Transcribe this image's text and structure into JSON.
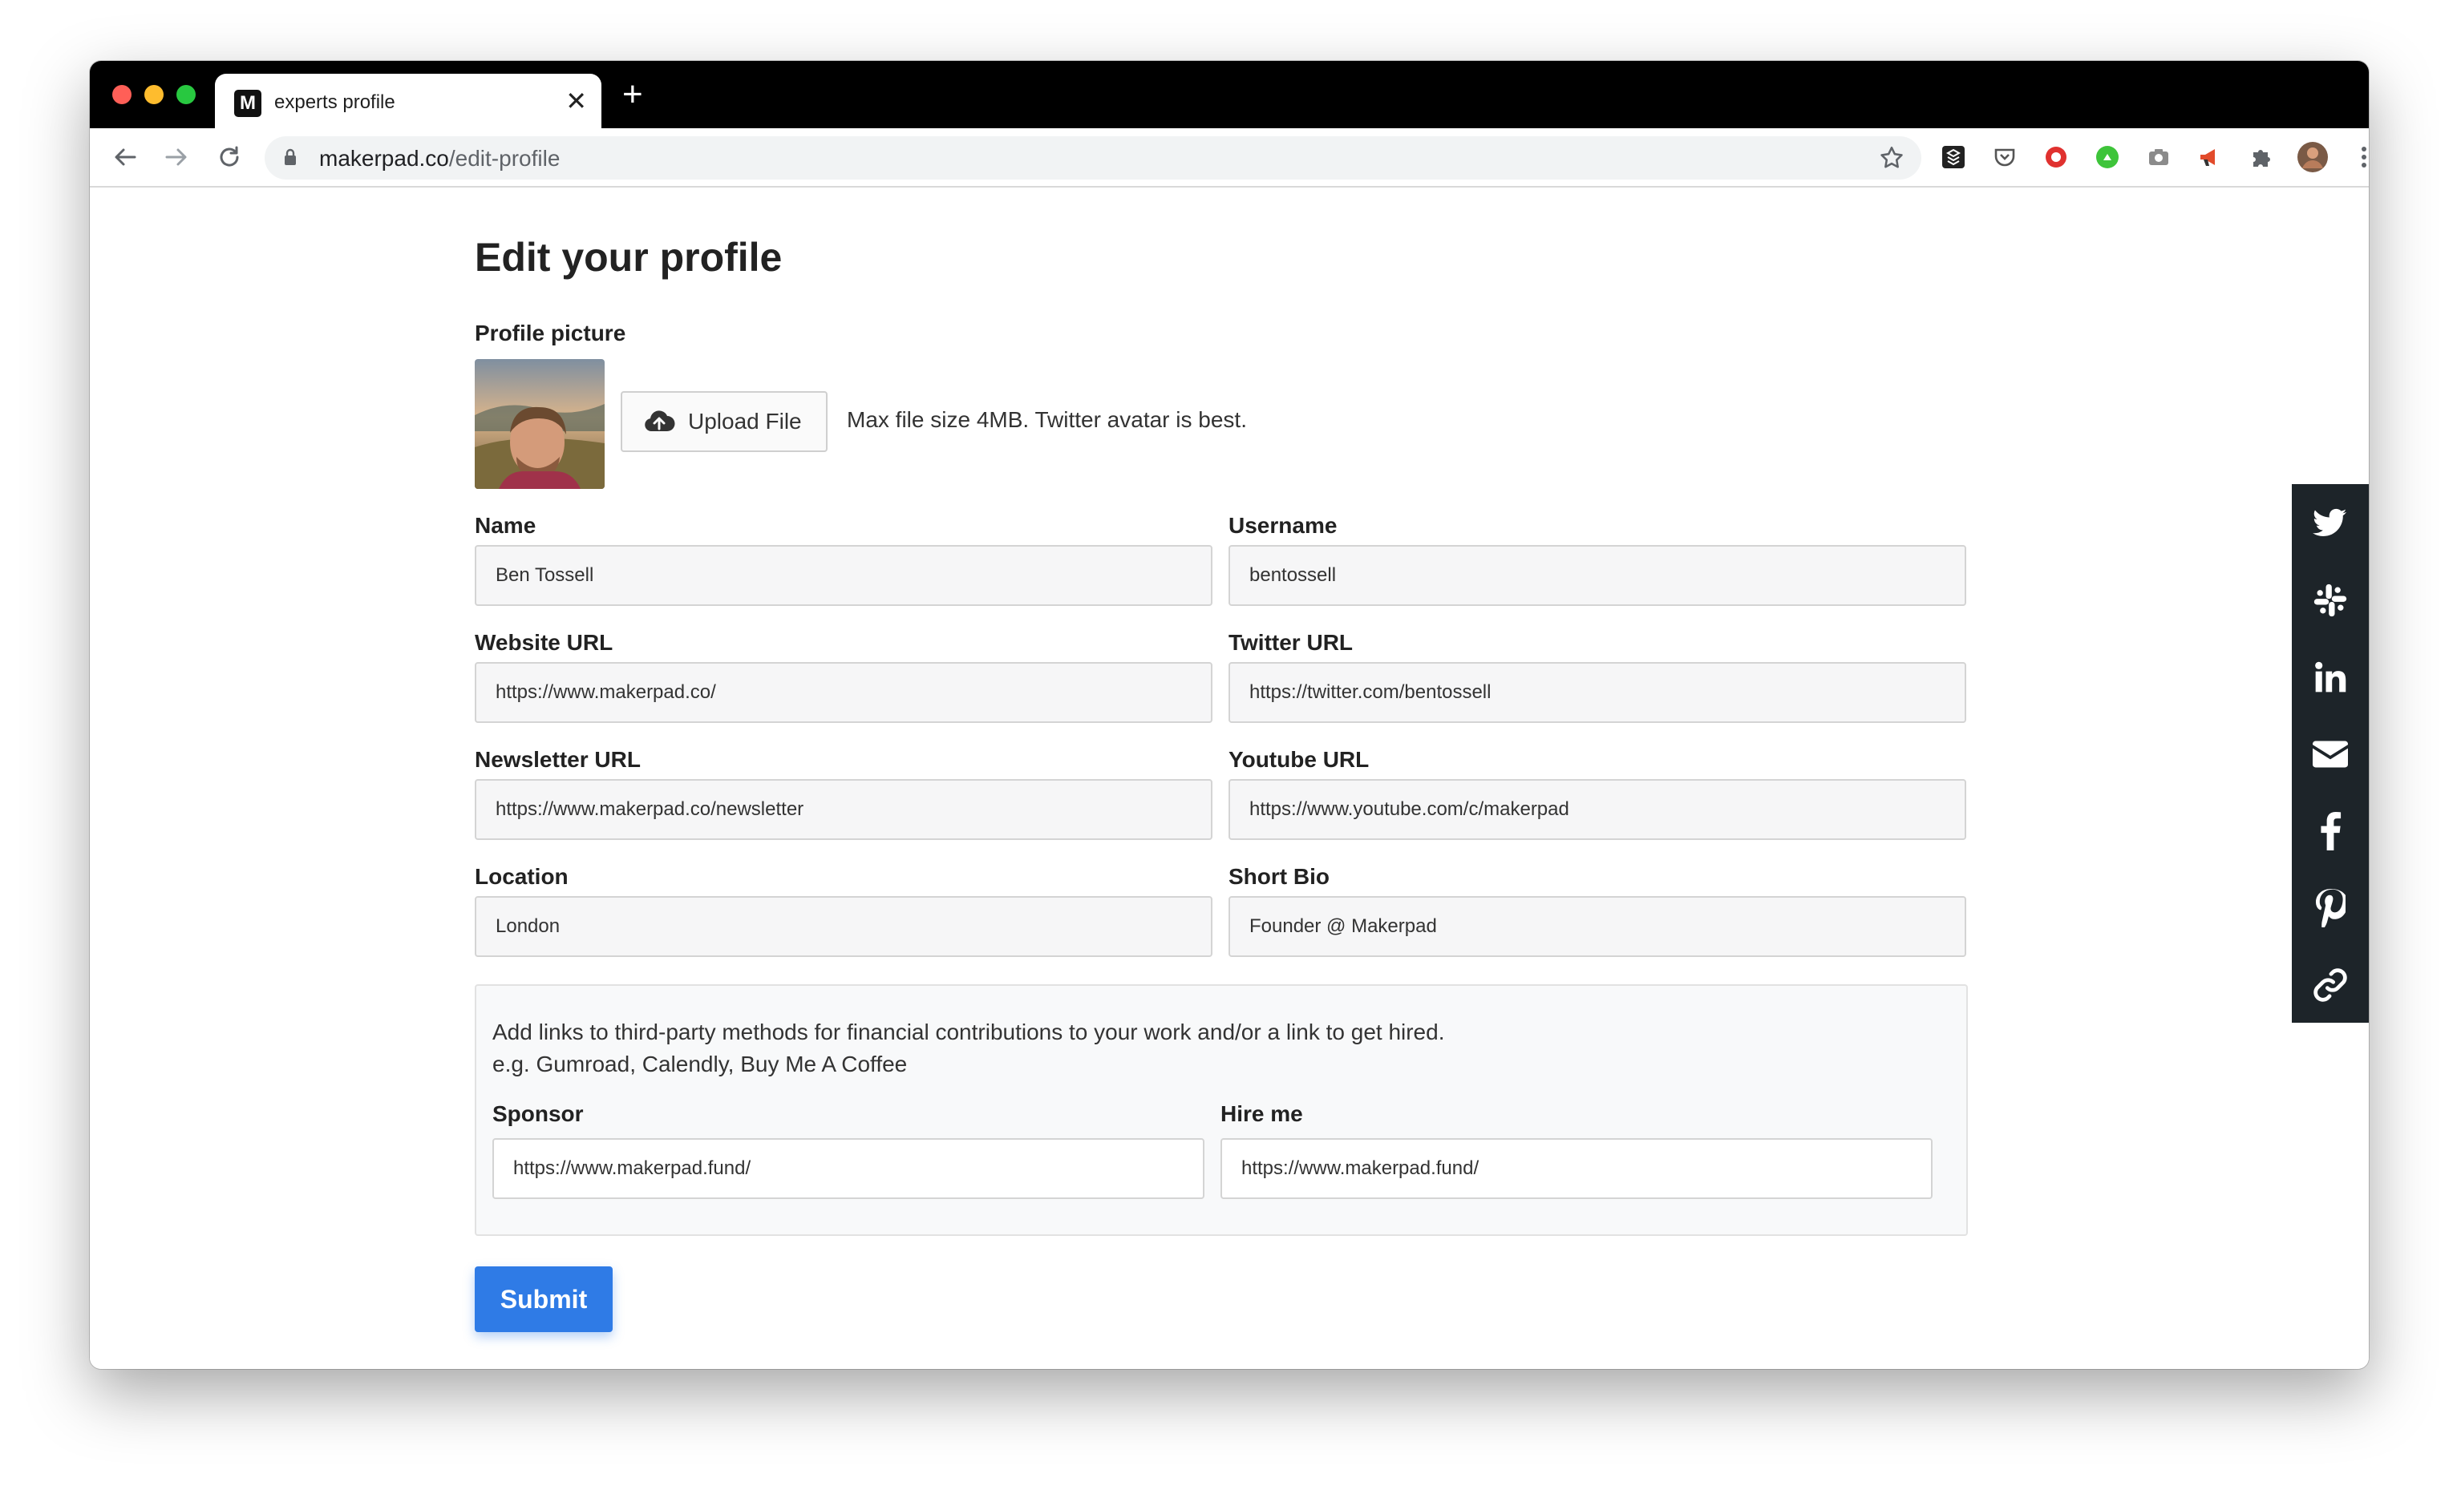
{
  "browser": {
    "tab_title": "experts profile",
    "favicon_letter": "M",
    "new_tab_label": "+",
    "tab_close_label": "✕",
    "url_host": "makerpad.co",
    "url_path": "/edit-profile"
  },
  "page": {
    "title": "Edit your profile",
    "profile_picture_label": "Profile picture",
    "upload_button_label": "Upload File",
    "upload_hint": "Max file size 4MB. Twitter avatar is best."
  },
  "fields": {
    "name": {
      "label": "Name",
      "value": "Ben Tossell"
    },
    "username": {
      "label": "Username",
      "value": "bentossell"
    },
    "website": {
      "label": "Website URL",
      "value": "https://www.makerpad.co/"
    },
    "twitter": {
      "label": "Twitter URL",
      "value": "https://twitter.com/bentossell"
    },
    "newsletter": {
      "label": "Newsletter URL",
      "value": "https://www.makerpad.co/newsletter"
    },
    "youtube": {
      "label": "Youtube URL",
      "value": "https://www.youtube.com/c/makerpad"
    },
    "location": {
      "label": "Location",
      "value": "London"
    },
    "bio": {
      "label": "Short Bio",
      "value": "Founder @ Makerpad"
    }
  },
  "funding": {
    "intro_line1": "Add links to third-party methods for financial contributions to your work and/or a link to get hired.",
    "intro_line2": "e.g. Gumroad, Calendly, Buy Me A Coffee",
    "sponsor": {
      "label": "Sponsor",
      "value": "https://www.makerpad.fund/"
    },
    "hire": {
      "label": "Hire me",
      "value": "https://www.makerpad.fund/"
    }
  },
  "submit_label": "Submit",
  "share_icons": [
    "twitter-icon",
    "slack-icon",
    "linkedin-icon",
    "email-icon",
    "facebook-icon",
    "pinterest-icon",
    "link-icon"
  ],
  "colors": {
    "accent": "#2f7be6",
    "share_bar": "#1d2429",
    "traffic_red": "#ff5f57",
    "traffic_yellow": "#febc2e",
    "traffic_green": "#28c840"
  }
}
